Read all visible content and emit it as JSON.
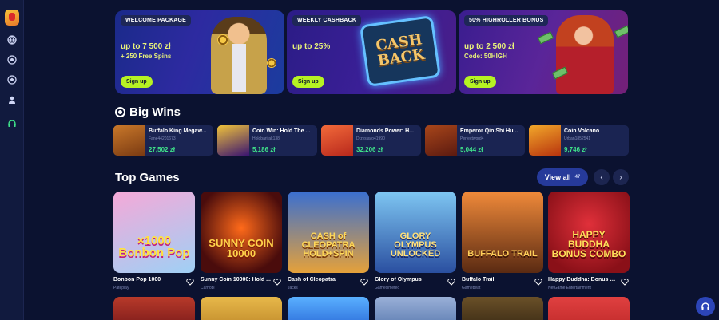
{
  "sidebar": {
    "items": [
      {
        "icon": "logo-icon"
      },
      {
        "icon": "globe-icon"
      },
      {
        "icon": "target-icon"
      },
      {
        "icon": "soccer-ball-icon"
      },
      {
        "icon": "user-icon"
      },
      {
        "icon": "headset-icon"
      }
    ]
  },
  "banners": [
    {
      "tag": "WELCOME PACKAGE",
      "main": "up to 7 500 zł",
      "sub": "+ 250 Free Spins",
      "button": "Sign up"
    },
    {
      "tag": "WEEKLY CASHBACK",
      "main": "up to 25%",
      "sub": "",
      "sign_line1": "CASH",
      "sign_line2": "BACK",
      "button": "Sign up"
    },
    {
      "tag": "50% HIGHROLLER BONUS",
      "main": "up to 2 500 zł",
      "sub": "Code: 50HIGH",
      "button": "Sign up"
    }
  ],
  "big_wins": {
    "title": "Big Wins",
    "items": [
      {
        "name": "Buffalo King Megaw...",
        "user": "Fane44201673",
        "amount": "27,502 zł",
        "color": "#7a3a12"
      },
      {
        "name": "Coin Win: Hold The ...",
        "user": "Holobarirak138",
        "amount": "5,186 zł",
        "color": "#3a1470"
      },
      {
        "name": "Diamonds Power: H...",
        "user": "Drzyslavo41990",
        "amount": "32,206 zł",
        "color": "#b8281c"
      },
      {
        "name": "Emperor Qin Shi Hu...",
        "user": "Perfectword4",
        "amount": "5,044 zł",
        "color": "#5c1a10"
      },
      {
        "name": "Coin Volcano",
        "user": "Urban1852541",
        "amount": "9,746 zł",
        "color": "#b8340e"
      }
    ]
  },
  "top_games": {
    "title": "Top Games",
    "view_all": "View all",
    "count": "47",
    "items": [
      {
        "name": "Bonbon Pop 1000",
        "provider": "Pateplay",
        "logo": "×1000 Bonbon Pop",
        "bg1": "#f5a9d8",
        "bg2": "#9fd0f5",
        "logo_color": "#ffe140"
      },
      {
        "name": "Sunny Coin 10000: Hold ...",
        "provider": "Carhobi",
        "logo": "SUNNY COIN 10000",
        "bg1": "#ff6a1a",
        "bg2": "#4a0c0c",
        "logo_color": "#ffd24a"
      },
      {
        "name": "Cash of Cleopatra",
        "provider": "Jacks",
        "logo": "CASH of CLEOPATRA HOLD+SPIN",
        "bg1": "#3a6fd0",
        "bg2": "#e5a13a",
        "logo_color": "#ffd95a"
      },
      {
        "name": "Glory of Olympus",
        "provider": "Gamecimetec",
        "logo": "GLORY OLYMPUS UNLOCKED",
        "bg1": "#7ec6f2",
        "bg2": "#2a4fa0",
        "logo_color": "#ffe07a"
      },
      {
        "name": "Buffalo Trail",
        "provider": "Gamebeat",
        "logo": "BUFFALO TRAIL",
        "bg1": "#f08a3a",
        "bg2": "#5a2a12",
        "logo_color": "#ffcf5a"
      },
      {
        "name": "Happy Buddha: Bonus C...",
        "provider": "NetGame Entertainment",
        "logo": "HAPPY BUDDHA BONUS COMBO",
        "bg1": "#e0303a",
        "bg2": "#8a1018",
        "logo_color": "#ffe05a"
      }
    ],
    "row2_colors": [
      "#7a1a1a",
      "#c08a2a",
      "#2a6ad8",
      "#5a7ab0",
      "#3a2a14",
      "#c02a2a"
    ]
  },
  "colors": {
    "accent": "#b6f223",
    "win": "#3fe28a",
    "background": "#0b1230",
    "card": "#1a2452"
  }
}
